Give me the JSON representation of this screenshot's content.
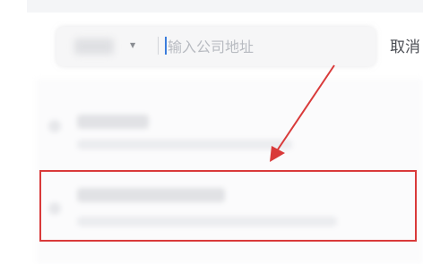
{
  "search": {
    "placeholder": "输入公司地址",
    "value": "",
    "city_selector_icon": "caret-down-icon"
  },
  "header": {
    "cancel_label": "取消"
  },
  "annotation": {
    "color": "#d93a3a",
    "type": "arrow-pointing-to-highlighted-result"
  },
  "colors": {
    "search_bg": "#f6f6f7",
    "cursor": "#3b7ddc",
    "highlight": "#d93a3a"
  }
}
